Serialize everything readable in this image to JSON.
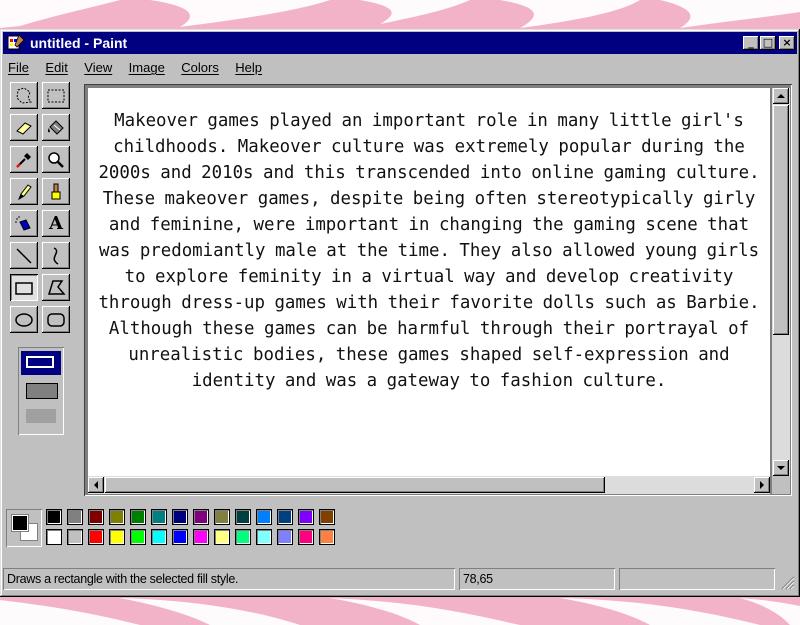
{
  "window": {
    "title": "untitled - Paint",
    "controls": {
      "minimize": "_",
      "maximize": "□",
      "close": "×"
    }
  },
  "menu": {
    "items": [
      {
        "label": "File"
      },
      {
        "label": "Edit"
      },
      {
        "label": "View"
      },
      {
        "label": "Image"
      },
      {
        "label": "Colors"
      },
      {
        "label": "Help"
      }
    ]
  },
  "toolbox": {
    "tools": [
      {
        "name": "free-form-select",
        "icon": "free-form-select-icon"
      },
      {
        "name": "select",
        "icon": "rect-select-icon"
      },
      {
        "name": "eraser",
        "icon": "eraser-icon"
      },
      {
        "name": "fill",
        "icon": "fill-bucket-icon"
      },
      {
        "name": "pick-color",
        "icon": "eyedropper-icon"
      },
      {
        "name": "magnifier",
        "icon": "magnifier-icon"
      },
      {
        "name": "pencil",
        "icon": "pencil-icon"
      },
      {
        "name": "brush",
        "icon": "brush-icon"
      },
      {
        "name": "airbrush",
        "icon": "airbrush-icon"
      },
      {
        "name": "text",
        "icon": "text-icon",
        "glyph": "A"
      },
      {
        "name": "line",
        "icon": "line-icon"
      },
      {
        "name": "curve",
        "icon": "curve-icon"
      },
      {
        "name": "rectangle",
        "icon": "rectangle-icon",
        "active": true
      },
      {
        "name": "polygon",
        "icon": "polygon-icon"
      },
      {
        "name": "ellipse",
        "icon": "ellipse-icon"
      },
      {
        "name": "rounded-rectangle",
        "icon": "rounded-rectangle-icon"
      }
    ],
    "fill_style_selected": "outline"
  },
  "canvas": {
    "text": "Makeover games played an important role in many little girl's childhoods. Makeover culture was extremely popular during the 2000s and 2010s and this transcended into online gaming culture. These makeover games, despite being often stereotypically girly and feminine, were important in changing the gaming scene that was predomiantly male at the time. They also allowed young girls to explore feminity in a virtual way and develop creativity through dress-up games with their favorite dolls such as Barbie. Although these games can be harmful through their portrayal of unrealistic bodies, these games shaped self-expression and identity and was a gateway to fashion culture."
  },
  "palette": {
    "foreground": "#000000",
    "background": "#ffffff",
    "top_row": [
      "#000000",
      "#808080",
      "#800000",
      "#808000",
      "#008000",
      "#008080",
      "#000080",
      "#800080",
      "#808040",
      "#004040",
      "#0080ff",
      "#004080",
      "#8000ff",
      "#804000"
    ],
    "bottom_row": [
      "#ffffff",
      "#c0c0c0",
      "#ff0000",
      "#ffff00",
      "#00ff00",
      "#00ffff",
      "#0000ff",
      "#ff00ff",
      "#ffff80",
      "#00ff80",
      "#80ffff",
      "#8080ff",
      "#ff0080",
      "#ff8040"
    ]
  },
  "status": {
    "message": "Draws a rectangle with the selected fill style.",
    "coordinates": "78,65",
    "size": ""
  },
  "colors": {
    "titlebar": "#000080",
    "window": "#c0c0c0",
    "backdrop": "#f2b3c8",
    "stripes": "#ffffff"
  }
}
